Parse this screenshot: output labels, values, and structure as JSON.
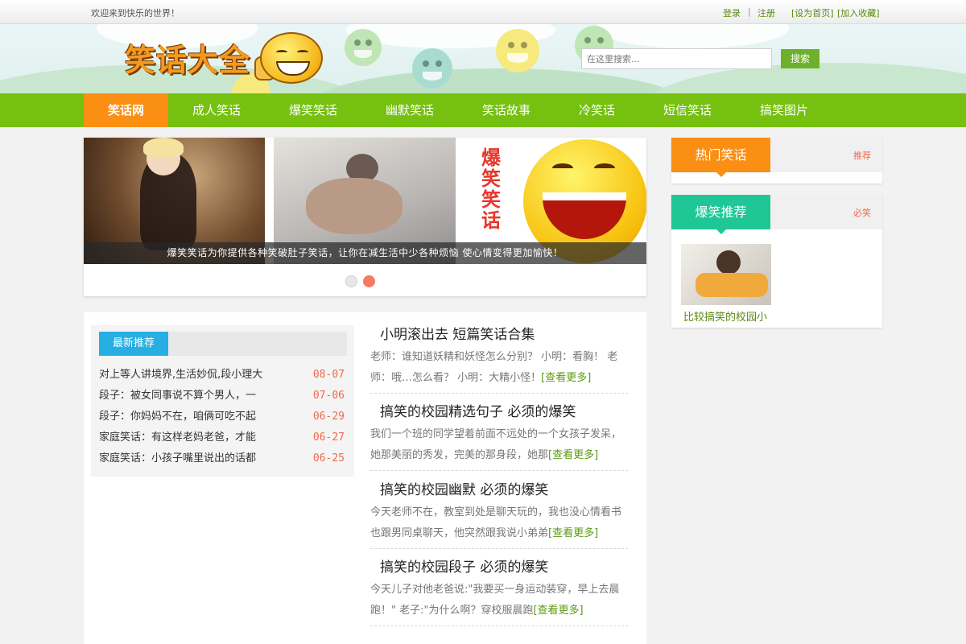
{
  "topbar": {
    "welcome": "欢迎来到快乐的世界！",
    "login": "登录",
    "separator": "|",
    "register": "注册",
    "set_home": "[设为首页]",
    "bookmark": "[加入收藏]"
  },
  "header": {
    "logo_text": "笑话大全",
    "search_placeholder": "在这里搜索...",
    "search_button": "搜索"
  },
  "nav": {
    "items": [
      {
        "label": "笑话网",
        "active": true
      },
      {
        "label": "成人笑话"
      },
      {
        "label": "爆笑笑话"
      },
      {
        "label": "幽默笑话"
      },
      {
        "label": "笑话故事"
      },
      {
        "label": "冷笑话"
      },
      {
        "label": "短信笑话"
      },
      {
        "label": "搞笑图片"
      }
    ]
  },
  "slider": {
    "caption": "爆笑笑话为你提供各种笑破肚子笑话，让你在减生活中少各种烦恼 使心情变得更加愉快！",
    "banner_text": "爆笑笑话",
    "dot_active_color": "#f47a62",
    "dot_inactive_color": "#e8e8e8"
  },
  "sidebar": {
    "hot": {
      "title": "热门笑话",
      "more": "推荐",
      "color": "#fb8f14"
    },
    "recommend": {
      "title": "爆笑推荐",
      "more": "必笑",
      "color": "#1ec795"
    },
    "pic_caption": "比较搞笑的校园小"
  },
  "latest": {
    "title": "最新推荐",
    "items": [
      {
        "title": "对上等人讲境界,生活妙侃,段小理大",
        "date": "08-07"
      },
      {
        "title": "段子：被女同事说不算个男人，一",
        "date": "07-06"
      },
      {
        "title": "段子：你妈妈不在，咱俩可吃不起",
        "date": "06-29"
      },
      {
        "title": "家庭笑话：有这样老妈老爸，才能",
        "date": "06-27"
      },
      {
        "title": "家庭笑话：小孩子嘴里说出的话都",
        "date": "06-25"
      }
    ]
  },
  "articles": [
    {
      "title": "小明滚出去 短篇笑话合集",
      "body": "老师：谁知道妖精和妖怪怎么分别？ 小明：看胸！ 老师：哦…怎么看？ 小明：大精小怪！",
      "more": "[查看更多]"
    },
    {
      "title": "搞笑的校园精选句子 必须的爆笑",
      "body": "我们一个班的同学望着前面不远处的一个女孩子发呆，她那美丽的秀发，完美的那身段，她那",
      "more": "[查看更多]"
    },
    {
      "title": "搞笑的校园幽默 必须的爆笑",
      "body": "今天老师不在，教室到处是聊天玩的，我也没心情看书也跟男同桌聊天，他突然跟我说小弟弟",
      "more": "[查看更多]"
    },
    {
      "title": "搞笑的校园段子 必须的爆笑",
      "body": "今天儿子对他老爸说:\"我要买一身运动装穿，早上去晨跑！\" 老子:\"为什么啊？穿校服晨跑",
      "more": "[查看更多]"
    }
  ]
}
